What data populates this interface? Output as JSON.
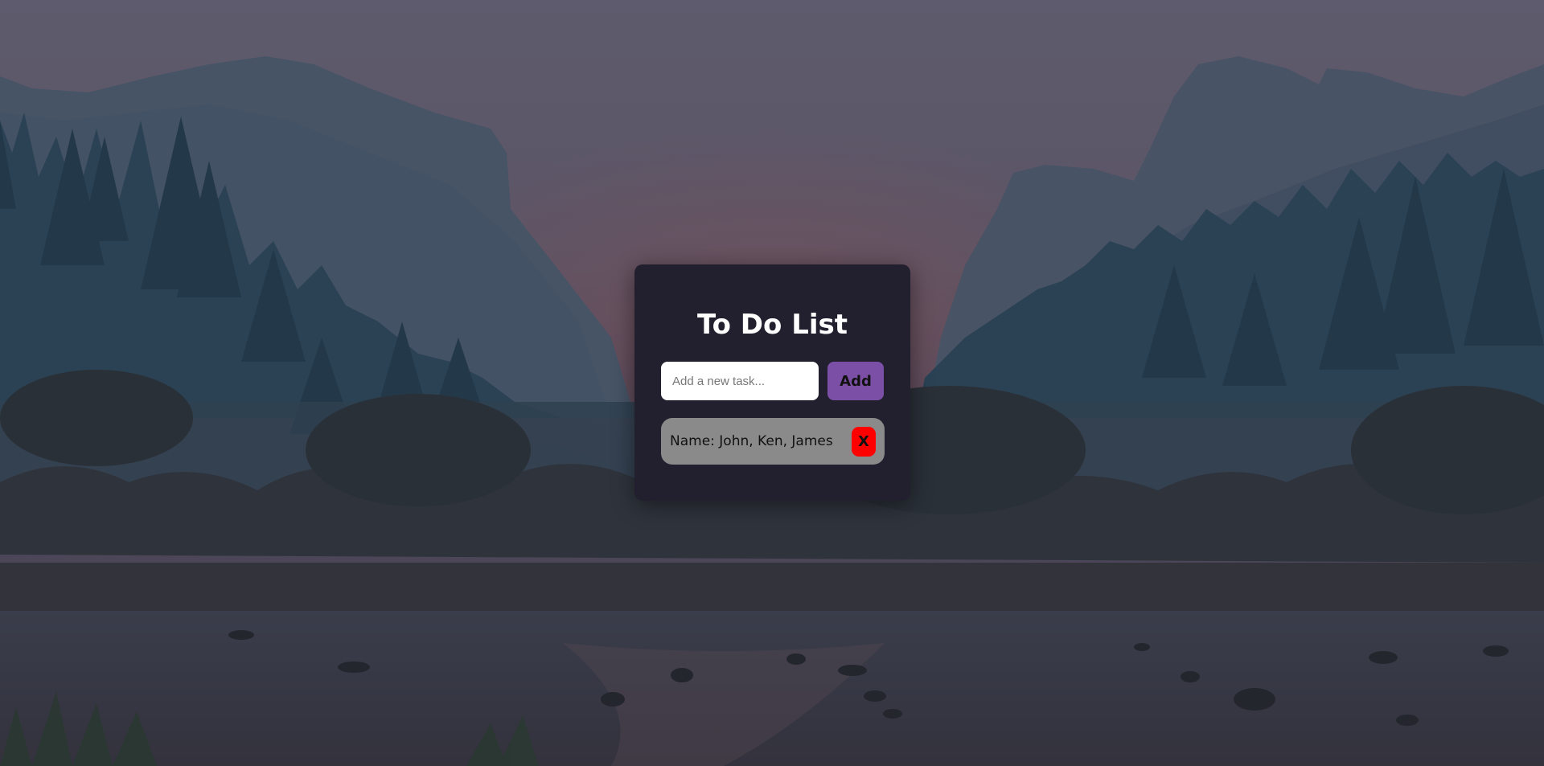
{
  "app": {
    "title": "To Do List"
  },
  "form": {
    "input_value": "",
    "input_placeholder": "Add a new task...",
    "add_label": "Add"
  },
  "tasks": [
    {
      "text": "Name: John, Ken, James",
      "delete_label": "X"
    }
  ],
  "colors": {
    "card_background": "#221f2e",
    "add_button": "#7b4fa5",
    "task_background": "#8a8a8a",
    "delete_button": "#ff0000"
  }
}
